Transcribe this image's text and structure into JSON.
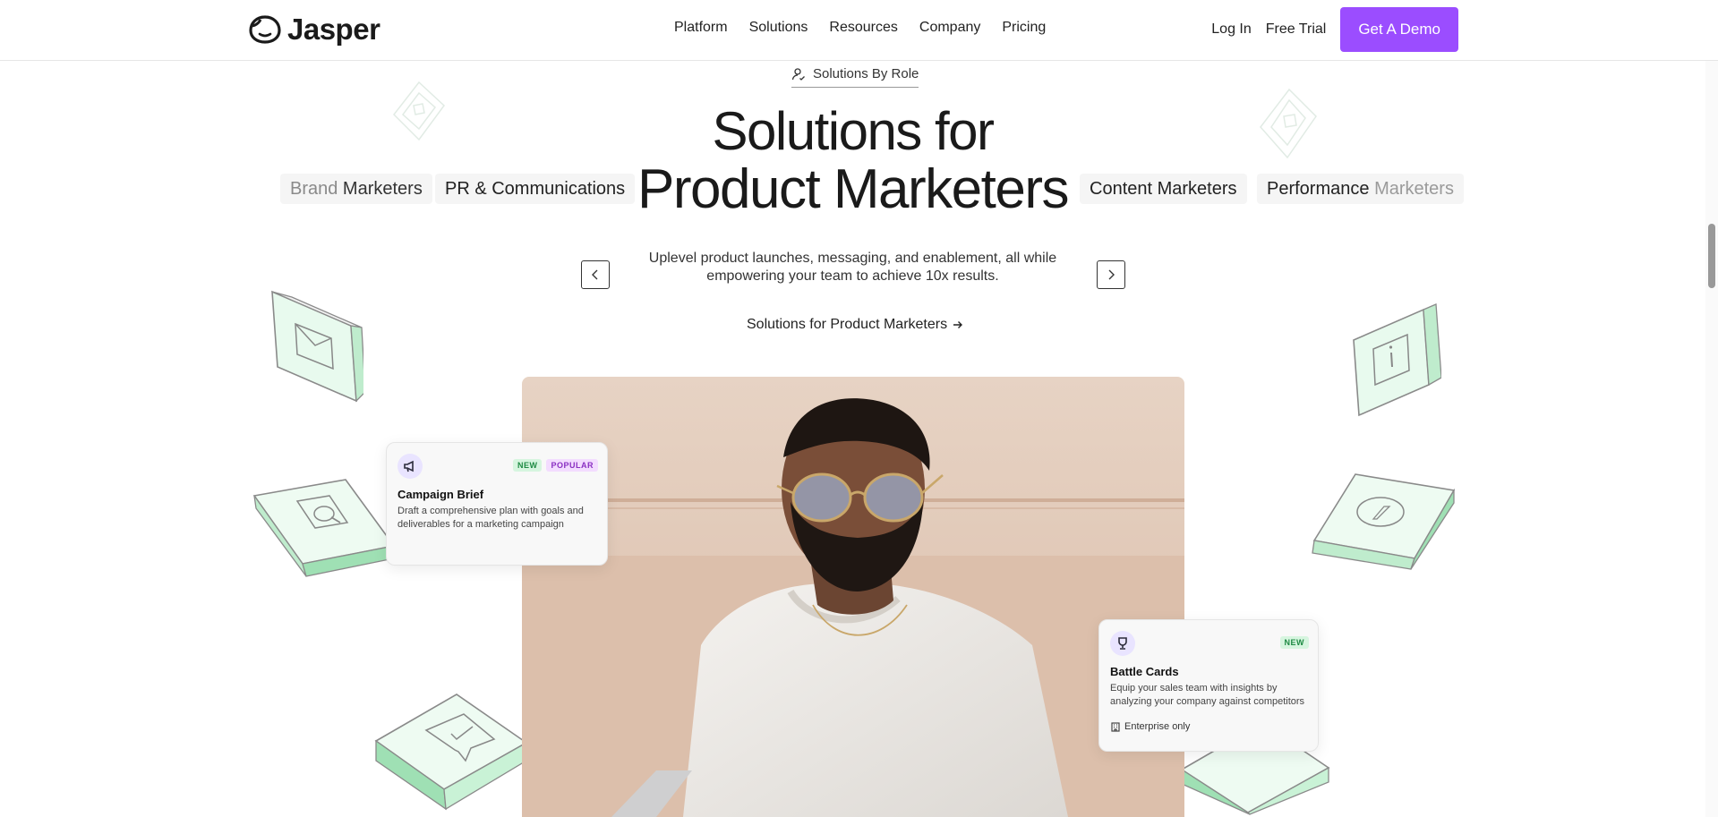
{
  "nav": {
    "logo_text": "Jasper",
    "links": [
      "Platform",
      "Solutions",
      "Resources",
      "Company",
      "Pricing"
    ],
    "login": "Log In",
    "free_trial": "Free Trial",
    "demo": "Get A Demo"
  },
  "hero": {
    "pill": "Solutions By Role",
    "title_line1": "Solutions for",
    "title_line2": "Product Marketers",
    "chips": {
      "brand_fade": "Brand",
      "brand_rest": " Marketers",
      "pr": "PR & Communications",
      "content": "Content Marketers",
      "perf_rest": "Performance ",
      "perf_fade": "Marketers"
    },
    "subtext": "Uplevel product launches, messaging, and enablement, all while empowering your team to achieve 10x results.",
    "cta": "Solutions for Product Marketers"
  },
  "cards": {
    "campaign": {
      "badge_new": "NEW",
      "badge_popular": "POPULAR",
      "title": "Campaign Brief",
      "desc": "Draft a comprehensive plan with goals and deliverables for a marketing campaign"
    },
    "battle": {
      "badge_new": "NEW",
      "title": "Battle Cards",
      "desc": "Equip your sales team with insights by analyzing your company against competitors",
      "foot": "Enterprise only"
    }
  },
  "colors": {
    "accent": "#9b4dff",
    "green_tint": "#c9f2d6",
    "badge_new": "#1e8a43",
    "badge_popular": "#8a2fc2"
  },
  "icons": [
    "jasper-logo-icon",
    "user-role-icon",
    "chevron-left-icon",
    "chevron-right-icon",
    "arrow-right-icon",
    "megaphone-icon",
    "trophy-icon",
    "building-icon"
  ]
}
